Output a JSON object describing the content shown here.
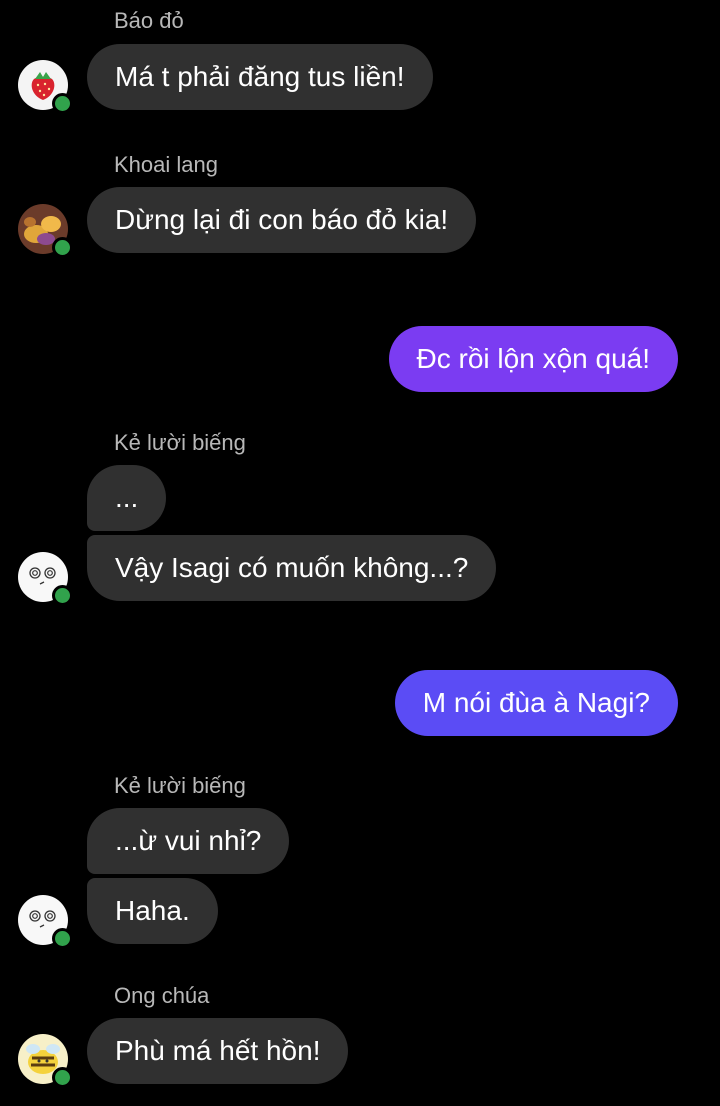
{
  "colors": {
    "background": "#000000",
    "incoming_bubble": "#303030",
    "outgoing_bubble_1": "#7b3cf2",
    "outgoing_bubble_2": "#5b4cf5",
    "sender_name": "#b8b8b8",
    "online": "#31a24c"
  },
  "messages": [
    {
      "sender": "Báo đỏ",
      "avatar": "strawberry-avatar-icon",
      "text": "Má t phải đăng tus liền!"
    },
    {
      "sender": "Khoai lang",
      "avatar": "sweet-potato-avatar-icon",
      "text": "Dừng lại đi con báo đỏ kia!"
    },
    {
      "sender": "",
      "direction": "outgoing",
      "text": "Đc rồi lộn xộn quá!"
    },
    {
      "sender": "Kẻ lười biếng",
      "avatar": "dizzy-face-avatar-icon",
      "texts": [
        "...",
        "Vậy Isagi có muốn không...?"
      ]
    },
    {
      "sender": "",
      "direction": "outgoing",
      "text": "M nói đùa à Nagi?"
    },
    {
      "sender": "Kẻ lười biếng",
      "avatar": "dizzy-face-avatar-icon",
      "texts": [
        "...ừ vui nhỉ?",
        "Haha."
      ]
    },
    {
      "sender": "Ong chúa",
      "avatar": "bee-avatar-icon",
      "text": "Phù má hết hồn!"
    }
  ]
}
